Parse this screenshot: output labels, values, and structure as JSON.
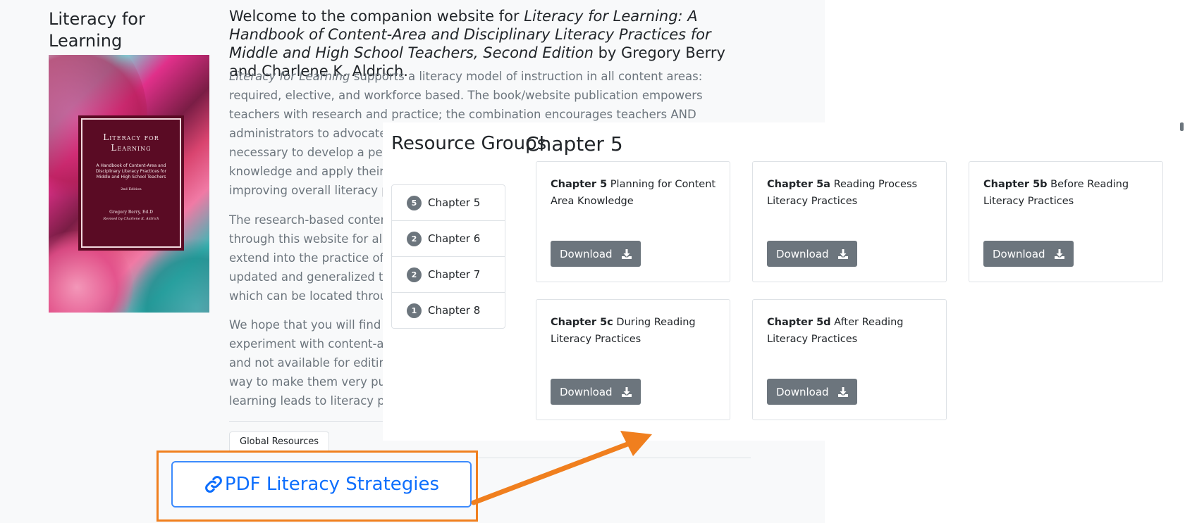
{
  "site": {
    "title": "Literacy for Learning",
    "cover": {
      "title": "Literacy for Learning",
      "subtitle": "A Handbook of Content-Area and Disciplinary Literacy Practices for Middle and High School Teachers",
      "edition": "2nd Edition",
      "author": "Gregory Berry, Ed.D",
      "reviser": "Revised by Charlene K. Aldrich"
    }
  },
  "main": {
    "welcome_prefix": "Welcome to the companion website for ",
    "welcome_title": "Literacy for Learning: A Handbook of Content-Area and Disciplinary Literacy Practices for Middle and High School Teachers, Second Edition",
    "welcome_suffix": " by Gregory Berry and Charlene K. Aldrich.",
    "p1_italic": "Literacy for Learning",
    "p1_rest": " supports a literacy model of instruction in all content areas: required, elective, and workforce based. The book/website publication empowers teachers with research and practice; the combination encourages teachers AND administrators to advocate for and require daily, independent content-ar",
    "p1_lines_extra": [
      "necessary to develop a perma",
      "knowledge and apply their lea",
      "improving overall literacy prof"
    ],
    "p2_lines": [
      "The research-based content-a",
      "through this website for all wh",
      "extend into the practice of dis",
      "updated and generalized to a",
      "which can be located through"
    ],
    "p3_lines": [
      "We hope that you will find the",
      "experiment with content-area",
      "and not available for editing,",
      "way to make them very purpo",
      "learning leads to literacy profi"
    ],
    "tab_global": "Global Resources"
  },
  "resource_groups": {
    "title": "Resource Groups",
    "items": [
      {
        "count": "5",
        "label": "Chapter 5"
      },
      {
        "count": "2",
        "label": "Chapter 6"
      },
      {
        "count": "2",
        "label": "Chapter 7"
      },
      {
        "count": "1",
        "label": "Chapter 8"
      }
    ]
  },
  "chapter": {
    "title": "Chapter 5",
    "cards": [
      {
        "code": "Chapter 5",
        "name": "Planning for Content Area Knowledge",
        "button": "Download"
      },
      {
        "code": "Chapter 5a",
        "name": "Reading Process Literacy Practices",
        "button": "Download"
      },
      {
        "code": "Chapter 5b",
        "name": "Before Reading Literacy Practices",
        "button": "Download"
      },
      {
        "code": "Chapter 5c",
        "name": "During Reading Literacy Practices",
        "button": "Download"
      },
      {
        "code": "Chapter 5d",
        "name": "After Reading Literacy Practices",
        "button": "Download"
      }
    ]
  },
  "pdf_link": {
    "label": "PDF Literacy Strategies",
    "icon": "link-icon"
  },
  "colors": {
    "highlight": "#f07f1e",
    "link": "#0d6efd",
    "button": "#6c757d"
  }
}
